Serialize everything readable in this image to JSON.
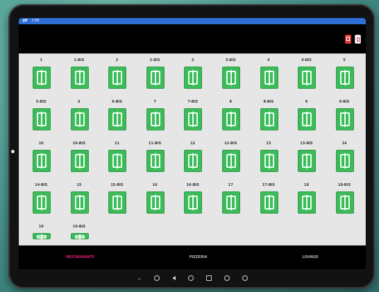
{
  "status_bar": {
    "time": "7:00"
  },
  "bottom_tabs": [
    {
      "label": "RESTAURANTE",
      "active": true
    },
    {
      "label": "PIZZERIA",
      "active": false
    },
    {
      "label": "LOUNGE",
      "active": false
    }
  ],
  "tables": [
    "1",
    "1-BIS",
    "2",
    "2-BIS",
    "3",
    "3-BIS",
    "4",
    "4-BIS",
    "5",
    "5-BIS",
    "6",
    "6-BIS",
    "7",
    "7-BIS",
    "8",
    "8-BIS",
    "9",
    "9-BIS",
    "10",
    "10-BIS",
    "11",
    "11-BIS",
    "12",
    "12-BIS",
    "13",
    "13-BIS",
    "14",
    "14-BIS",
    "15",
    "15-BIS",
    "16",
    "16-BIS",
    "17",
    "17-BIS",
    "18",
    "18-BIS",
    "19",
    "19-BIS"
  ],
  "colors": {
    "table_free": "#3dbb5a",
    "status_bar": "#2f6fd6",
    "active_tab": "#e0207a",
    "action_red": "#e03a3a"
  },
  "icons": {
    "table": "table-icon",
    "action_1": "clipboard-icon",
    "action_2": "document-icon"
  }
}
